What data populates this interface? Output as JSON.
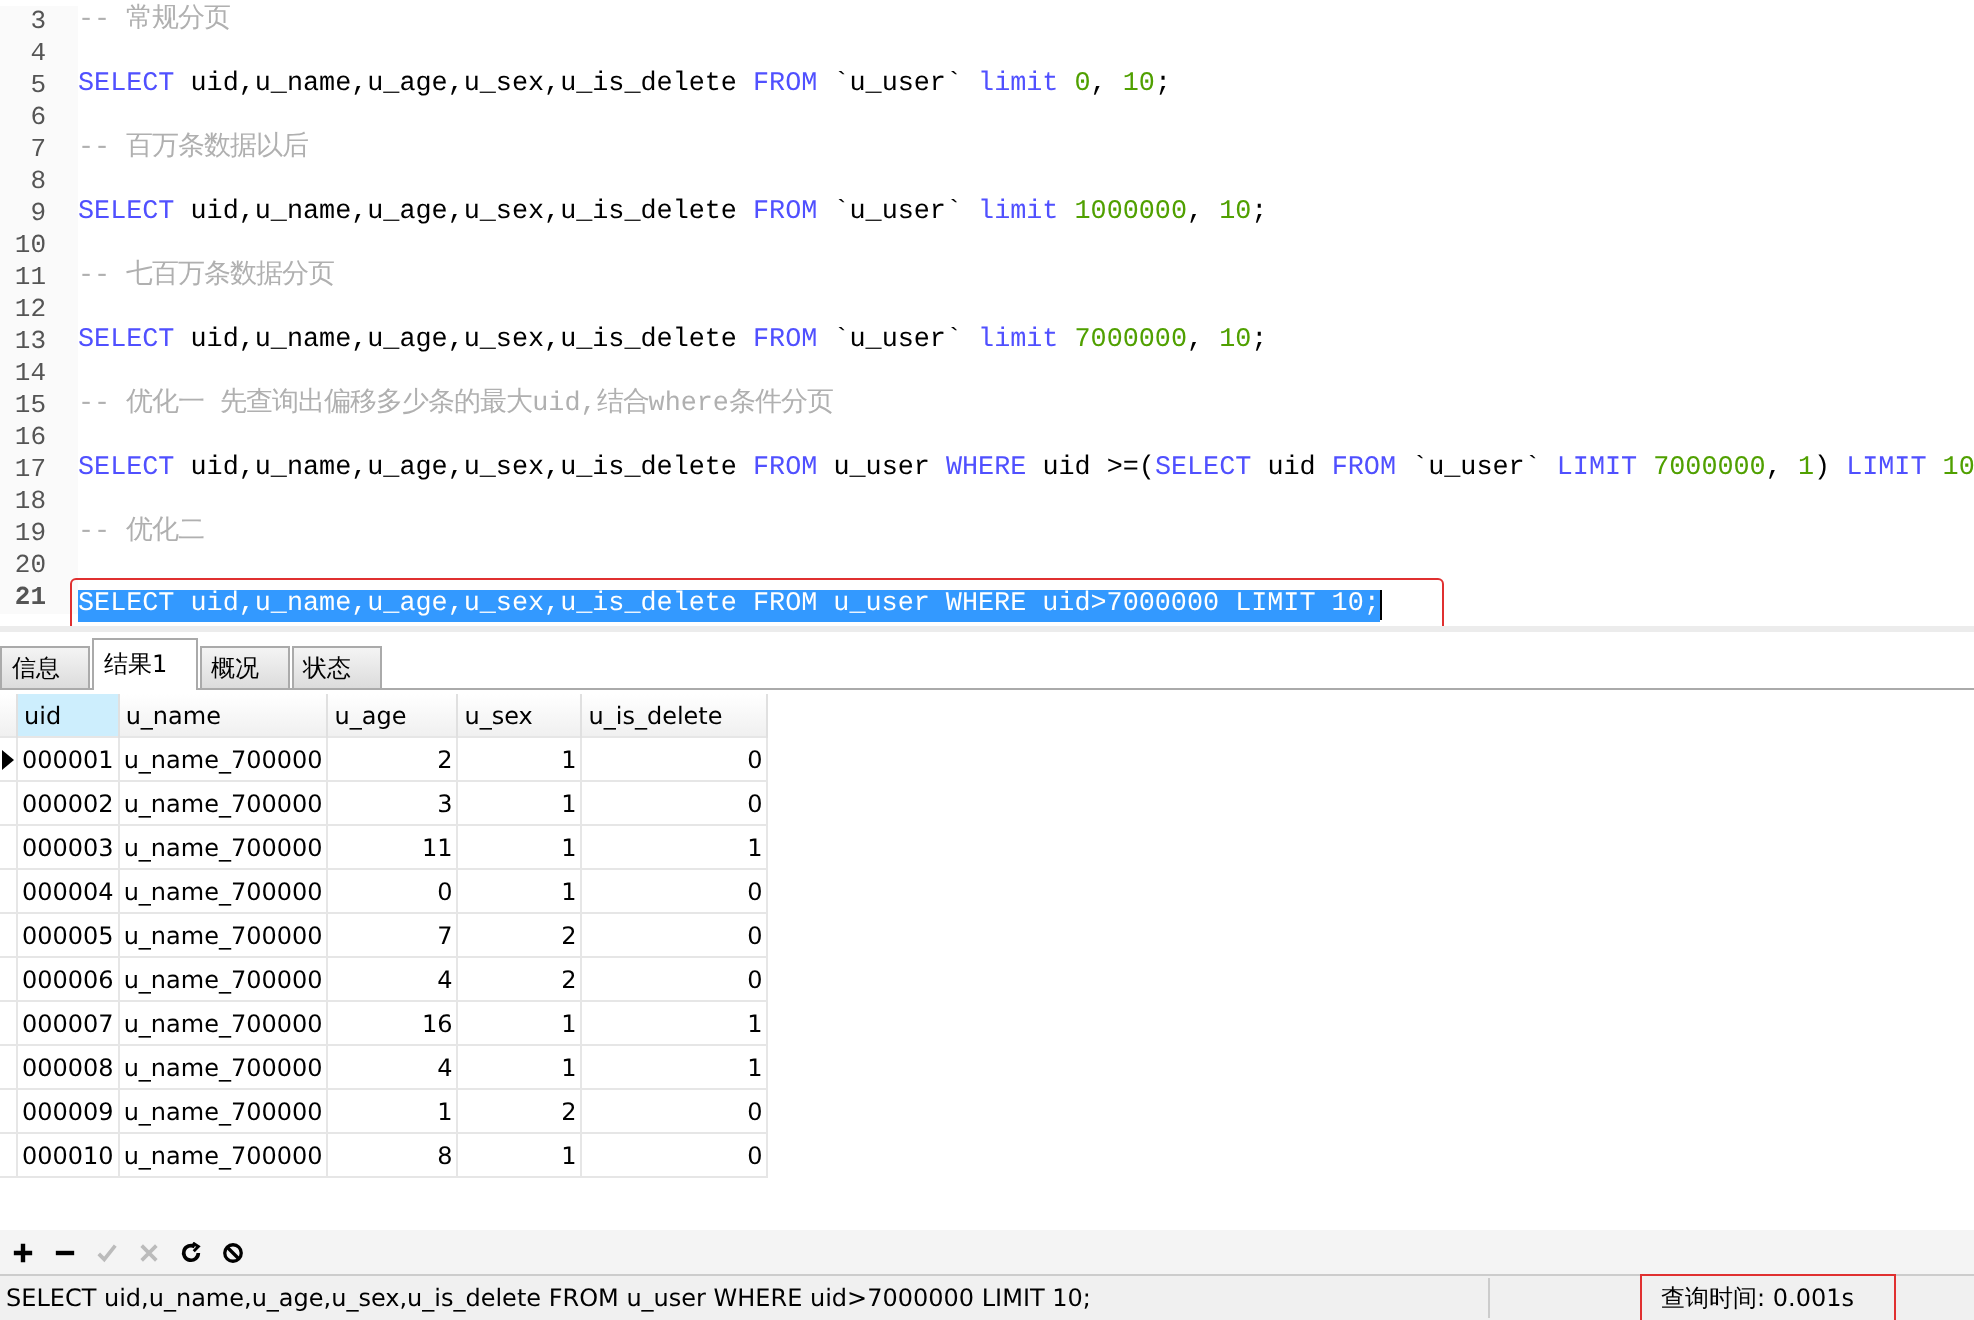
{
  "editor": {
    "lines": [
      {
        "num": "3",
        "selected": false,
        "tokens": [
          {
            "kind": "comment",
            "text": "-- 常规分页"
          }
        ]
      },
      {
        "num": "4",
        "selected": false
      },
      {
        "num": "5",
        "selected": false,
        "tokens": [
          {
            "kind": "keyword",
            "text": "SELECT"
          },
          {
            "kind": "plain",
            "text": " uid,u_name,u_age,u_sex,u_is_delete "
          },
          {
            "kind": "keyword",
            "text": "FROM"
          },
          {
            "kind": "plain",
            "text": " `u_user` "
          },
          {
            "kind": "keyword",
            "text": "limit"
          },
          {
            "kind": "number",
            "text": " 0"
          },
          {
            "kind": "plain",
            "text": ", "
          },
          {
            "kind": "number",
            "text": "10"
          },
          {
            "kind": "plain",
            "text": ";"
          }
        ]
      },
      {
        "num": "6",
        "selected": false
      },
      {
        "num": "7",
        "selected": false,
        "tokens": [
          {
            "kind": "comment",
            "text": "-- 百万条数据以后"
          }
        ]
      },
      {
        "num": "8",
        "selected": false
      },
      {
        "num": "9",
        "selected": false,
        "tokens": [
          {
            "kind": "keyword",
            "text": "SELECT"
          },
          {
            "kind": "plain",
            "text": " uid,u_name,u_age,u_sex,u_is_delete "
          },
          {
            "kind": "keyword",
            "text": "FROM"
          },
          {
            "kind": "plain",
            "text": " `u_user` "
          },
          {
            "kind": "keyword",
            "text": "limit"
          },
          {
            "kind": "number",
            "text": " 1000000"
          },
          {
            "kind": "plain",
            "text": ", "
          },
          {
            "kind": "number",
            "text": "10"
          },
          {
            "kind": "plain",
            "text": ";"
          }
        ]
      },
      {
        "num": "10",
        "selected": false
      },
      {
        "num": "11",
        "selected": false,
        "tokens": [
          {
            "kind": "comment",
            "text": "-- 七百万条数据分页"
          }
        ]
      },
      {
        "num": "12",
        "selected": false
      },
      {
        "num": "13",
        "selected": false,
        "tokens": [
          {
            "kind": "keyword",
            "text": "SELECT"
          },
          {
            "kind": "plain",
            "text": " uid,u_name,u_age,u_sex,u_is_delete "
          },
          {
            "kind": "keyword",
            "text": "FROM"
          },
          {
            "kind": "plain",
            "text": " `u_user` "
          },
          {
            "kind": "keyword",
            "text": "limit"
          },
          {
            "kind": "number",
            "text": " 7000000"
          },
          {
            "kind": "plain",
            "text": ", "
          },
          {
            "kind": "number",
            "text": "10"
          },
          {
            "kind": "plain",
            "text": ";"
          }
        ]
      },
      {
        "num": "14",
        "selected": false
      },
      {
        "num": "15",
        "selected": false,
        "tokens": [
          {
            "kind": "comment",
            "text": "-- 优化一 先查询出偏移多少条的最大uid,结合where条件分页"
          }
        ]
      },
      {
        "num": "16",
        "selected": false
      },
      {
        "num": "17",
        "selected": false,
        "tokens": [
          {
            "kind": "keyword",
            "text": "SELECT"
          },
          {
            "kind": "plain",
            "text": " uid,u_name,u_age,u_sex,u_is_delete "
          },
          {
            "kind": "keyword",
            "text": "FROM"
          },
          {
            "kind": "plain",
            "text": " u_user "
          },
          {
            "kind": "keyword",
            "text": "WHERE"
          },
          {
            "kind": "plain",
            "text": " uid >=("
          },
          {
            "kind": "keyword",
            "text": "SELECT"
          },
          {
            "kind": "plain",
            "text": " uid "
          },
          {
            "kind": "keyword",
            "text": "FROM"
          },
          {
            "kind": "plain",
            "text": " `u_user` "
          },
          {
            "kind": "keyword",
            "text": "LIMIT"
          },
          {
            "kind": "number",
            "text": " 7000000"
          },
          {
            "kind": "plain",
            "text": ", "
          },
          {
            "kind": "number",
            "text": "1"
          },
          {
            "kind": "plain",
            "text": ") "
          },
          {
            "kind": "keyword",
            "text": "LIMIT"
          },
          {
            "kind": "number",
            "text": " 10"
          }
        ]
      },
      {
        "num": "18",
        "selected": false
      },
      {
        "num": "19",
        "selected": false,
        "tokens": [
          {
            "kind": "comment",
            "text": "-- 优化二"
          }
        ]
      },
      {
        "num": "20",
        "selected": false
      },
      {
        "num": "21",
        "selected": true,
        "text": "SELECT uid,u_name,u_age,u_sex,u_is_delete FROM u_user WHERE uid>7000000 LIMIT 10;"
      }
    ]
  },
  "tabs": [
    {
      "label": "信息",
      "selected": false
    },
    {
      "label": "结果1",
      "selected": true
    },
    {
      "label": "概况",
      "selected": false
    },
    {
      "label": "状态",
      "selected": false
    }
  ],
  "table": {
    "columns": [
      "uid",
      "u_name",
      "u_age",
      "u_sex",
      "u_is_delete"
    ],
    "rows": [
      {
        "current": true,
        "cells": [
          "000001",
          "u_name_700000",
          "2",
          "1",
          "0"
        ]
      },
      {
        "current": false,
        "cells": [
          "000002",
          "u_name_700000",
          "3",
          "1",
          "0"
        ]
      },
      {
        "current": false,
        "cells": [
          "000003",
          "u_name_700000",
          "11",
          "1",
          "1"
        ]
      },
      {
        "current": false,
        "cells": [
          "000004",
          "u_name_700000",
          "0",
          "1",
          "0"
        ]
      },
      {
        "current": false,
        "cells": [
          "000005",
          "u_name_700000",
          "7",
          "2",
          "0"
        ]
      },
      {
        "current": false,
        "cells": [
          "000006",
          "u_name_700000",
          "4",
          "2",
          "0"
        ]
      },
      {
        "current": false,
        "cells": [
          "000007",
          "u_name_700000",
          "16",
          "1",
          "1"
        ]
      },
      {
        "current": false,
        "cells": [
          "000008",
          "u_name_700000",
          "4",
          "1",
          "1"
        ]
      },
      {
        "current": false,
        "cells": [
          "000009",
          "u_name_700000",
          "1",
          "2",
          "0"
        ]
      },
      {
        "current": false,
        "cells": [
          "000010",
          "u_name_700000",
          "8",
          "1",
          "0"
        ]
      }
    ]
  },
  "toolbar": [
    {
      "kind": "add",
      "disabled": false
    },
    {
      "kind": "remove",
      "disabled": false
    },
    {
      "kind": "apply",
      "disabled": true
    },
    {
      "kind": "cancel",
      "disabled": true
    },
    {
      "kind": "refresh",
      "disabled": false
    },
    {
      "kind": "stop",
      "disabled": false
    }
  ],
  "status_bar": {
    "query": "SELECT uid,u_name,u_age,u_sex,u_is_delete FROM u_user WHERE uid>7000000 LIMIT 10;",
    "time": "查询时间: 0.001s"
  }
}
